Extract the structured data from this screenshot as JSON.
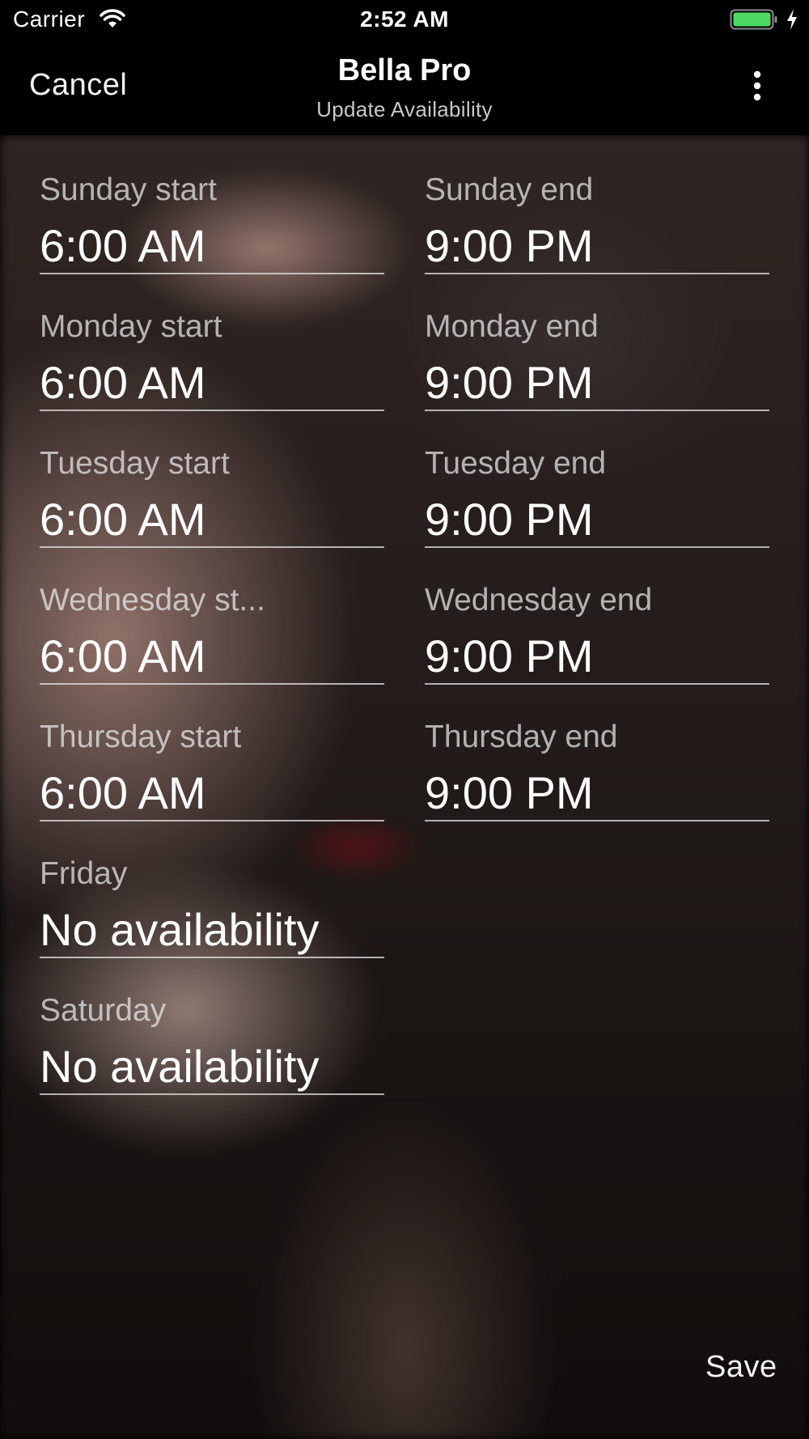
{
  "status_bar": {
    "carrier": "Carrier",
    "time": "2:52 AM",
    "icons": [
      "wifi-icon",
      "battery-icon",
      "charging-bolt-icon"
    ],
    "battery_color": "#4cd964"
  },
  "nav": {
    "cancel_label": "Cancel",
    "title": "Bella Pro",
    "subtitle": "Update Availability",
    "menu_icon": "more-vertical-icon"
  },
  "availability": {
    "sunday_start": {
      "label": "Sunday start",
      "value": "6:00 AM"
    },
    "sunday_end": {
      "label": "Sunday end",
      "value": "9:00 PM"
    },
    "monday_start": {
      "label": "Monday start",
      "value": "6:00 AM"
    },
    "monday_end": {
      "label": "Monday end",
      "value": "9:00 PM"
    },
    "tuesday_start": {
      "label": "Tuesday start",
      "value": "6:00 AM"
    },
    "tuesday_end": {
      "label": "Tuesday end",
      "value": "9:00 PM"
    },
    "wednesday_start": {
      "label": "Wednesday st...",
      "value": "6:00 AM"
    },
    "wednesday_end": {
      "label": "Wednesday end",
      "value": "9:00 PM"
    },
    "thursday_start": {
      "label": "Thursday start",
      "value": "6:00 AM"
    },
    "thursday_end": {
      "label": "Thursday end",
      "value": "9:00 PM"
    },
    "friday": {
      "label": "Friday",
      "value": "No availability"
    },
    "saturday": {
      "label": "Saturday",
      "value": "No availability"
    }
  },
  "footer": {
    "save_label": "Save"
  }
}
